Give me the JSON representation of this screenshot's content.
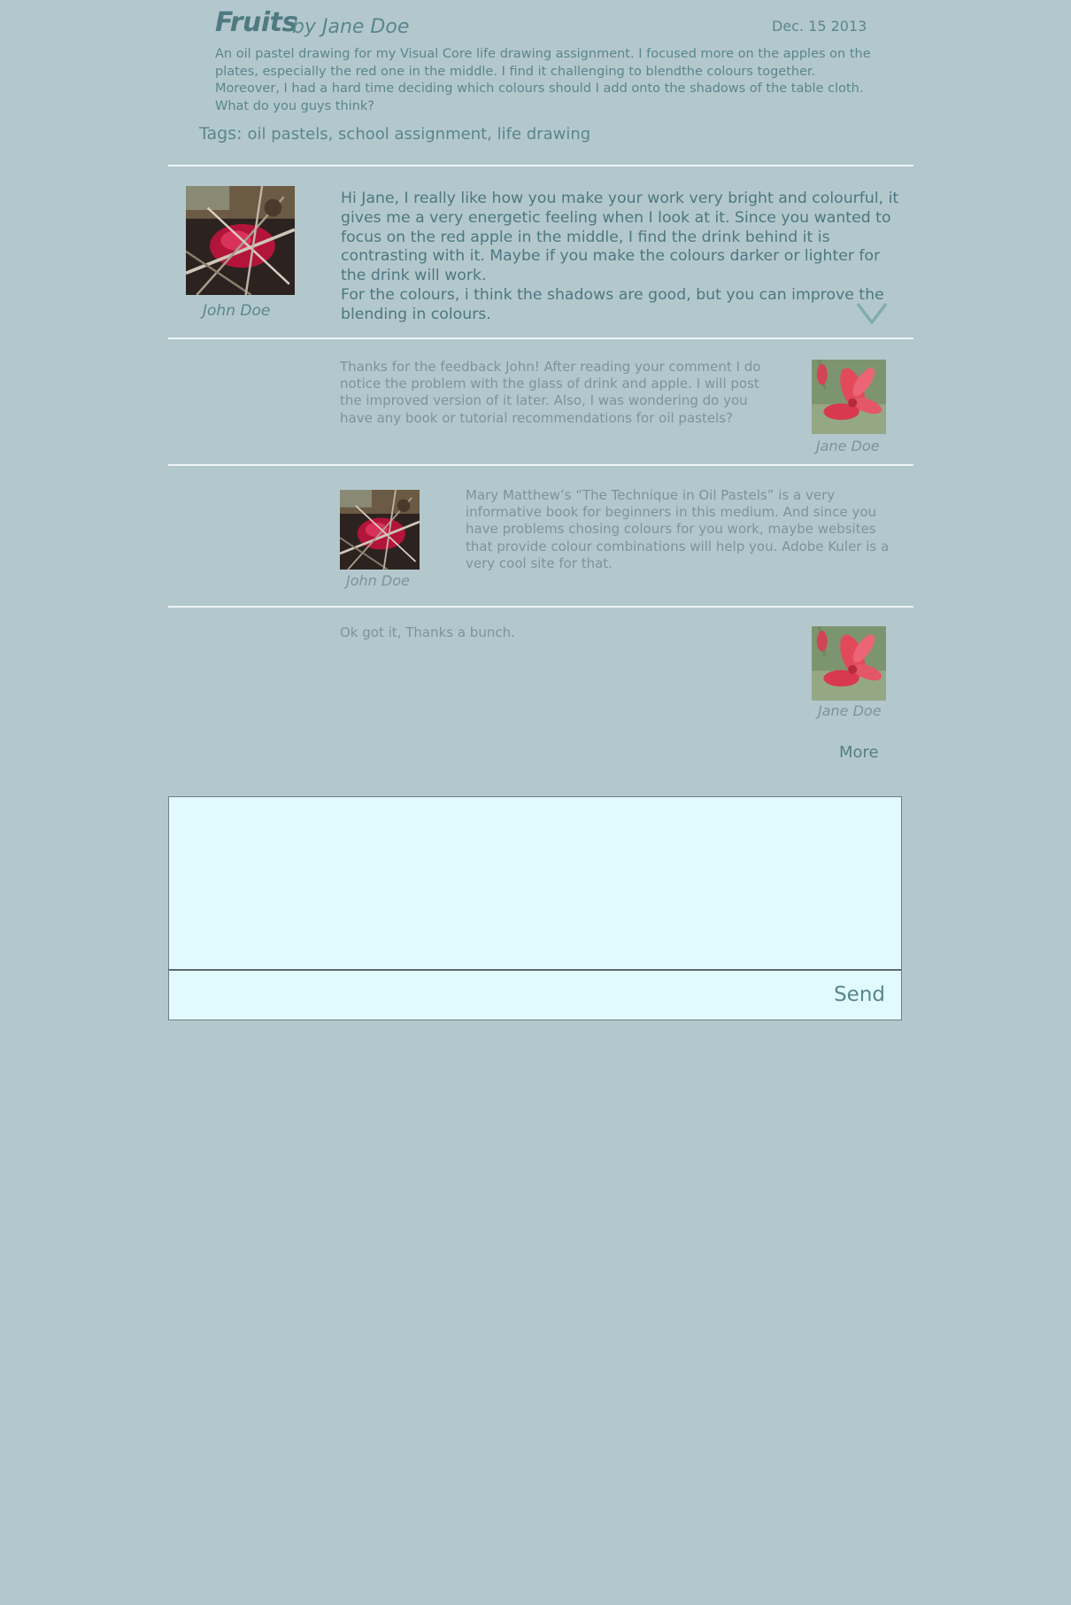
{
  "post": {
    "title": "Fruits",
    "byline": "by Jane Doe",
    "date": "Dec. 15 2013",
    "description": "An oil pastel drawing for my Visual Core life drawing assignment. I focused more on the apples on the plates, especially the red one in the middle. I find it challenging to blendthe colours together. Moreover, I had a hard time deciding which colours should I add onto the shadows of the table cloth. What do you guys think?",
    "tags_label": "Tags:",
    "tags": "oil pastels, school assignment, life drawing"
  },
  "comments": [
    {
      "author": "John Doe",
      "text": "Hi Jane, I really like how you make your work very bright and colourful, it gives me a very energetic feeling when I look at it. Since you wanted to focus on the red apple in the middle, I find the drink behind it is contrasting with it. Maybe if you make the colours darker or lighter for the drink will work.\nFor the colours, i think the shadows are good, but you can improve the blending in colours."
    },
    {
      "author": "Jane Doe",
      "text": "Thanks for the feedback John! After reading your comment I do notice the problem with the glass of drink and apple. I will post the improved version of it later. Also, I was wondering do you have any book or tutorial recommendations for oil pastels?"
    },
    {
      "author": "John Doe",
      "text": "Mary Matthew’s “The Technique in Oil Pastels” is a very informative book for beginners in this medium. And since you have problems chosing colours for you work, maybe websites that provide colour combinations will help you. Adobe Kuler is a very cool site for that."
    },
    {
      "author": "Jane Doe",
      "text": "Ok got it, Thanks a bunch."
    }
  ],
  "more_label": "More",
  "compose": {
    "placeholder": "",
    "send_label": "Send"
  },
  "colors": {
    "background": "#b3c8cd",
    "compose_background": "#e0fafe",
    "text_primary": "#4d7880",
    "text_muted": "#7a959a",
    "divider": "#eef5f6"
  },
  "icons": {
    "expand": "chevron-down-icon"
  }
}
